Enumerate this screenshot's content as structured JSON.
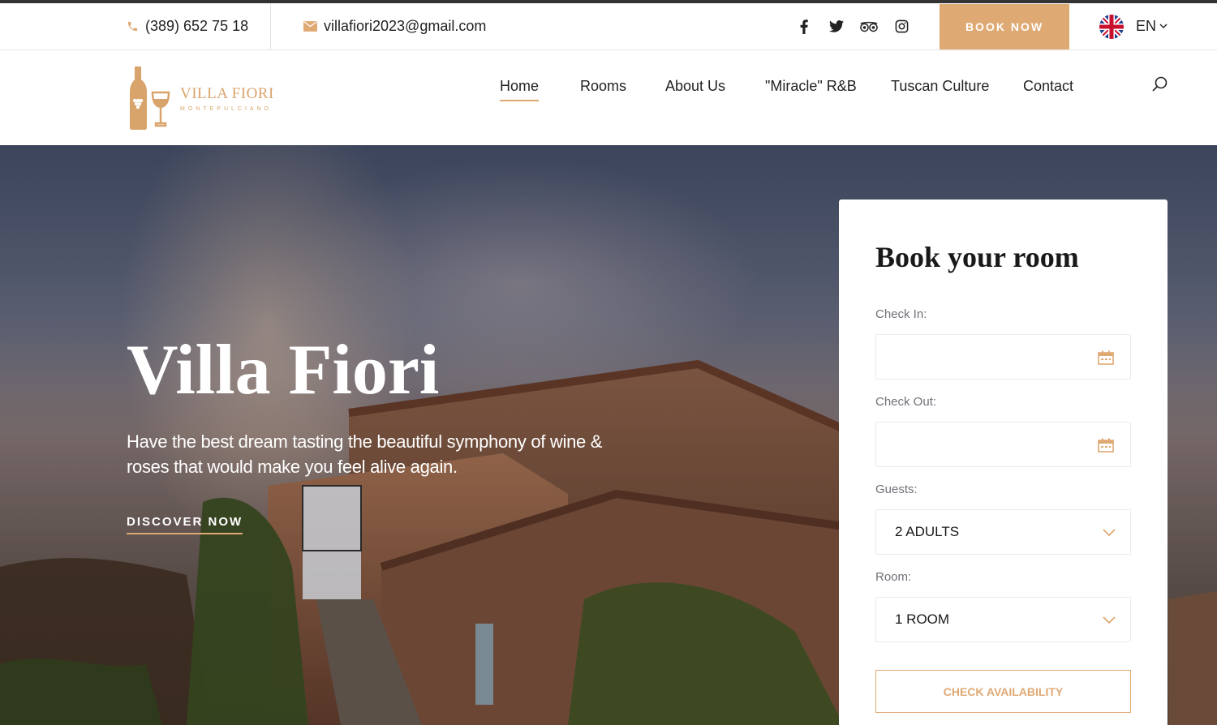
{
  "topbar": {
    "phone": "(389) 652 75 18",
    "email": "villafiori2023@gmail.com",
    "socials": [
      "facebook-icon",
      "twitter-icon",
      "tripadvisor-icon",
      "instagram-icon"
    ],
    "book_now": "BOOK NOW",
    "language": "EN"
  },
  "logo": {
    "name": "VILLA FIORI",
    "subtitle": "MONTEPULCIANO"
  },
  "nav": {
    "items": [
      {
        "label": "Home",
        "active": true
      },
      {
        "label": "Rooms"
      },
      {
        "label": "About Us"
      },
      {
        "label": "\"Miracle\" R&B"
      },
      {
        "label": "Tuscan Culture"
      },
      {
        "label": "Contact"
      }
    ]
  },
  "hero": {
    "title": "Villa Fiori",
    "subtitle": "Have the best dream tasting the beautiful symphony of wine & roses that would make you feel alive again.",
    "cta": "DISCOVER NOW"
  },
  "booking": {
    "title": "Book your room",
    "check_in_label": "Check In:",
    "check_in_value": "",
    "check_out_label": "Check Out:",
    "check_out_value": "",
    "guests_label": "Guests:",
    "guests_value": "2 ADULTS",
    "room_label": "Room:",
    "room_value": "1 ROOM",
    "submit": "CHECK AVAILABILITY"
  },
  "colors": {
    "accent": "#dfa974",
    "text_dark": "#19191a",
    "label_gray": "#707079"
  }
}
